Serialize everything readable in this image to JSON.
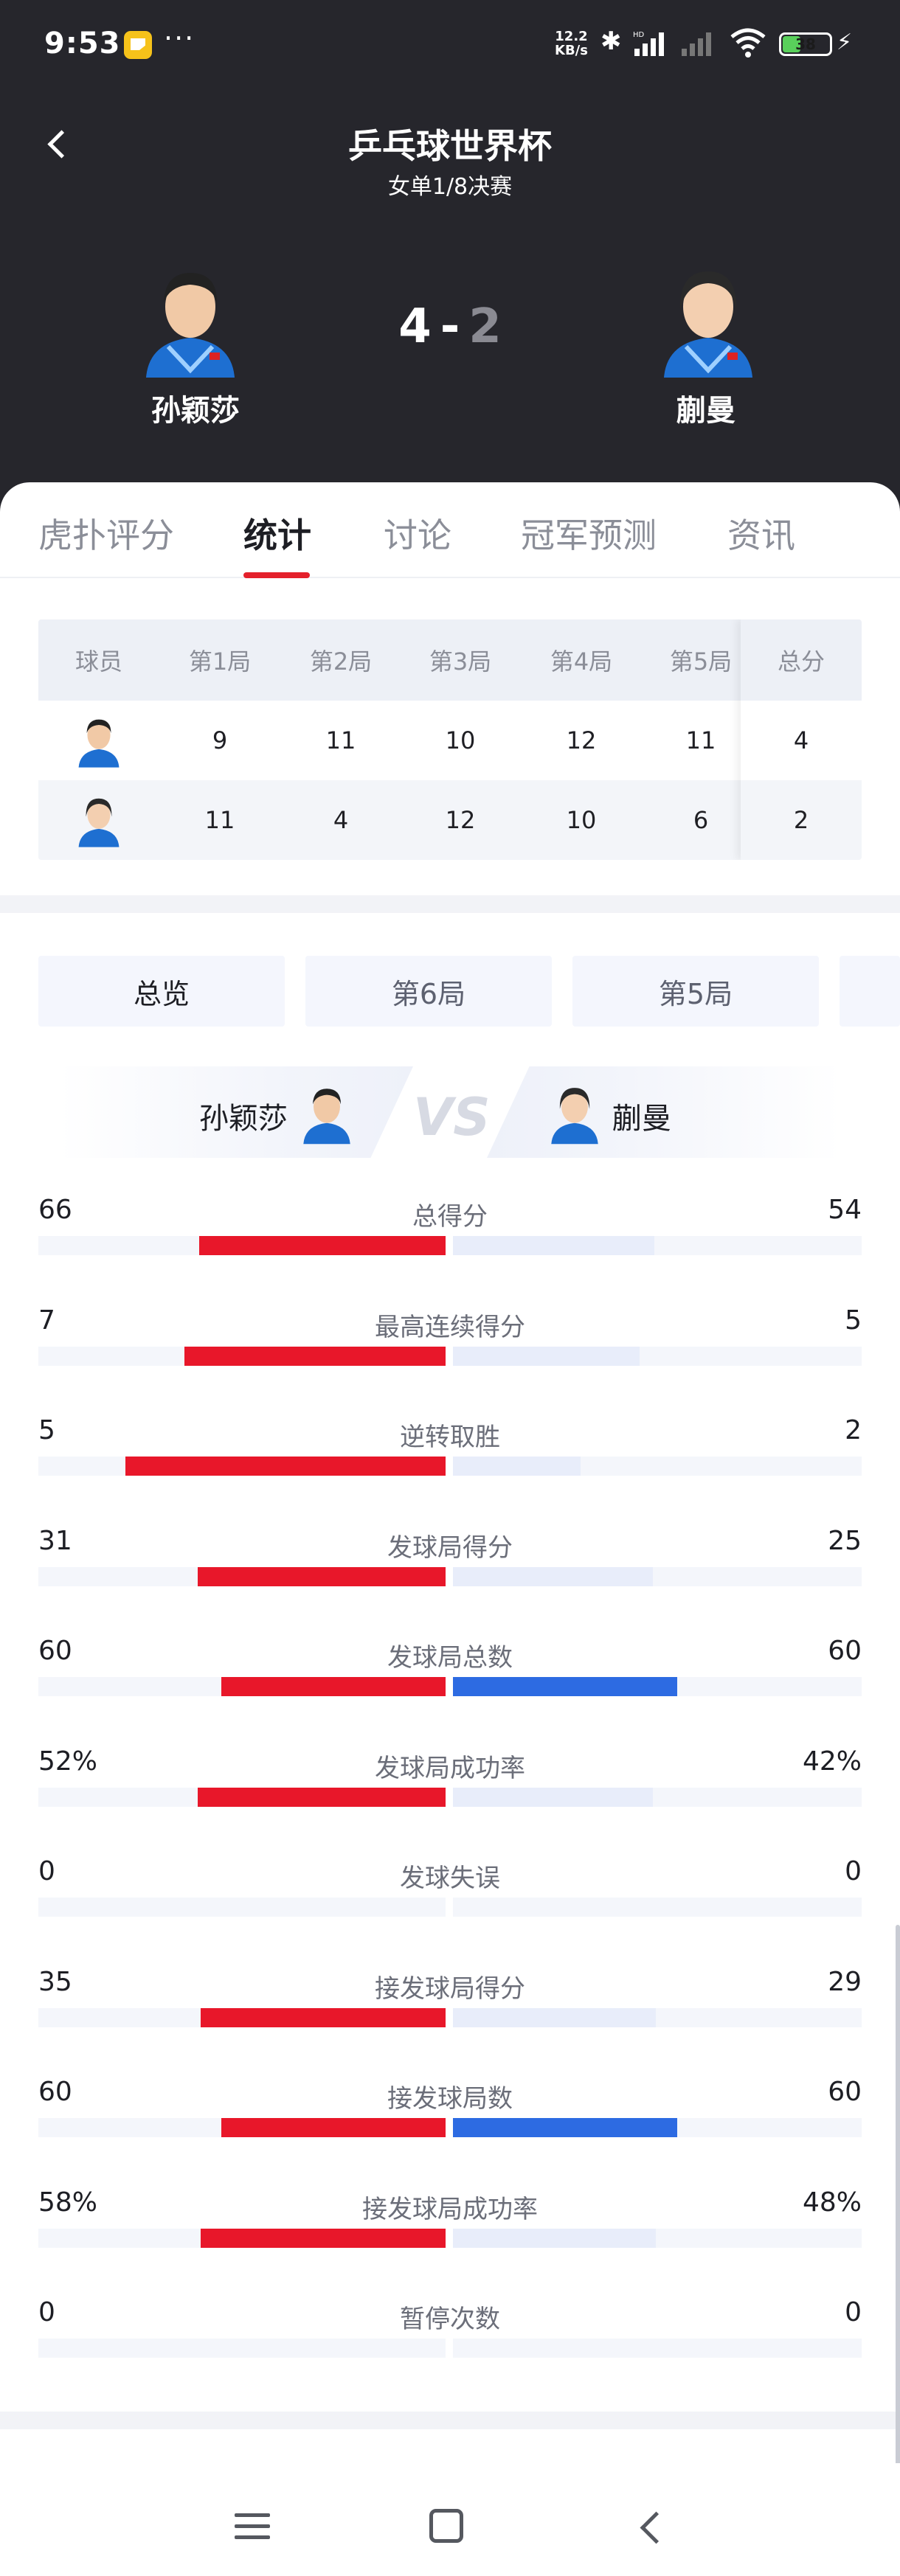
{
  "status_bar": {
    "time": "9:53",
    "more_dots": "···",
    "net_speed_value": "12.2",
    "net_speed_unit": "KB/s",
    "battery": "38",
    "battery_level_percent": 38,
    "bluetooth_icon": "bluetooth-icon",
    "signal_icon": "signal-icon",
    "wifi_icon": "wifi-icon",
    "charging_icon": "charging-bolt-icon",
    "bolt_glyph": "⚡",
    "bt_glyph": "✱"
  },
  "header": {
    "title": "乒乓球世界杯",
    "subtitle": "女单1/8决赛",
    "home_player": "孙颖莎",
    "away_player": "蒯曼",
    "home_score": "4",
    "separator": "-",
    "away_score": "2"
  },
  "tabs": [
    {
      "label": "虎扑评分",
      "active": false
    },
    {
      "label": "统计",
      "active": true
    },
    {
      "label": "讨论",
      "active": false
    },
    {
      "label": "冠军预测",
      "active": false
    },
    {
      "label": "资讯",
      "active": false
    }
  ],
  "game_table": {
    "headers": [
      "球员",
      "第1局",
      "第2局",
      "第3局",
      "第4局",
      "第5局",
      "总分"
    ],
    "rows": [
      {
        "player": "孙颖莎",
        "games": [
          "9",
          "11",
          "10",
          "12",
          "11"
        ],
        "total": "4"
      },
      {
        "player": "蒯曼",
        "games": [
          "11",
          "4",
          "12",
          "10",
          "6"
        ],
        "total": "2"
      }
    ]
  },
  "subtabs": [
    {
      "label": "总览",
      "active": true
    },
    {
      "label": "第6局",
      "active": false
    },
    {
      "label": "第5局",
      "active": false
    }
  ],
  "vs": {
    "home_name": "孙颖莎",
    "away_name": "蒯曼",
    "vs_text": "VS"
  },
  "stats": [
    {
      "label": "总得分",
      "home": "66",
      "away": "54",
      "home_val": 66,
      "away_val": 54
    },
    {
      "label": "最高连续得分",
      "home": "7",
      "away": "5",
      "home_val": 7,
      "away_val": 5
    },
    {
      "label": "逆转取胜",
      "home": "5",
      "away": "2",
      "home_val": 5,
      "away_val": 2
    },
    {
      "label": "发球局得分",
      "home": "31",
      "away": "25",
      "home_val": 31,
      "away_val": 25
    },
    {
      "label": "发球局总数",
      "home": "60",
      "away": "60",
      "home_val": 60,
      "away_val": 60
    },
    {
      "label": "发球局成功率",
      "home": "52%",
      "away": "42%",
      "home_val": 52,
      "away_val": 42
    },
    {
      "label": "发球失误",
      "home": "0",
      "away": "0",
      "home_val": 0,
      "away_val": 0
    },
    {
      "label": "接发球局得分",
      "home": "35",
      "away": "29",
      "home_val": 35,
      "away_val": 29
    },
    {
      "label": "接发球局数",
      "home": "60",
      "away": "60",
      "home_val": 60,
      "away_val": 60
    },
    {
      "label": "接发球局成功率",
      "home": "58%",
      "away": "48%",
      "home_val": 58,
      "away_val": 48
    },
    {
      "label": "暂停次数",
      "home": "0",
      "away": "0",
      "home_val": 0,
      "away_val": 0
    }
  ],
  "colors": {
    "header_bg": "#26262c",
    "accent_red": "#e8172a",
    "away_light": "#e8edfa",
    "away_blue": "#2d6be2"
  },
  "nav": {
    "menu_icon": "menu-icon",
    "home_icon": "home-square-icon",
    "back_icon": "back-chevron-icon"
  }
}
